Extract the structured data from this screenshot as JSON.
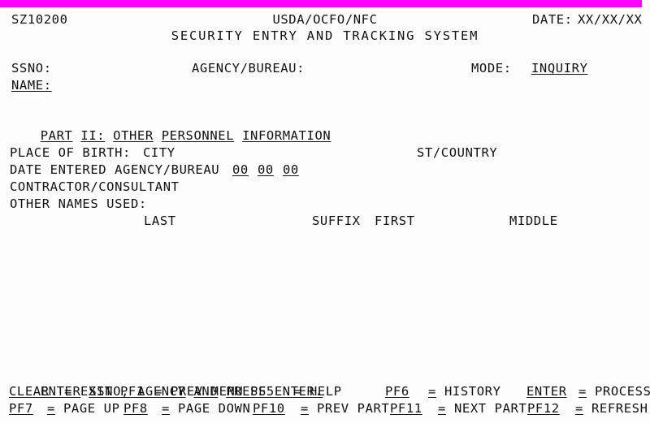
{
  "screen": {
    "id": "SZ10200",
    "bar_color": "#ff00ff",
    "background": "#fdfdfd",
    "text_color": "#111111"
  },
  "header": {
    "screen_id": "SZ10200",
    "org_line": "USDA/OCFO/NFC",
    "system_title": "SECURITY ENTRY AND TRACKING SYSTEM",
    "date_label": "DATE:",
    "date_value": "XX/XX/XX"
  },
  "key_fields": {
    "ssno_label": "SSNO:",
    "ssno_value": "",
    "agency_label": "AGENCY/BUREAU:",
    "agency_value": "",
    "mode_label": "MODE:",
    "mode_value": "INQUIRY",
    "name_label": "NAME:",
    "name_value": ""
  },
  "part": {
    "words": [
      "PART",
      "II:",
      "OTHER",
      "PERSONNEL",
      "INFORMATION"
    ],
    "w0": "PART",
    "w1": "II:",
    "w2": "OTHER",
    "w3": "PERSONNEL",
    "w4": "INFORMATION"
  },
  "body": {
    "place_of_birth_label": "PLACE OF BIRTH:",
    "city_label": "CITY",
    "st_country_label": "ST/COUNTRY",
    "date_entered_label": "DATE ENTERED AGENCY/BUREAU",
    "date_mm": "00",
    "date_dd": "00",
    "date_yy": "00",
    "contractor_label": "CONTRACTOR/CONSULTANT",
    "other_names_label": "OTHER NAMES USED:",
    "col_last": "LAST",
    "col_suffix": "SUFFIX",
    "col_first": "FIRST",
    "col_middle": "MIDDLE"
  },
  "footer": {
    "instruction_words": [
      "ENTER",
      "SSNO,",
      "AGENCY",
      "AND",
      "PRESS",
      "ENTER."
    ],
    "i0": "ENTER",
    "i1": "SSNO,",
    "i2": "AGENCY",
    "i3": "AND",
    "i4": "PRESS",
    "i5": "ENTER.",
    "line1": [
      {
        "key": "CLEAR",
        "eq": "=",
        "action": "EXIT"
      },
      {
        "key": "PF1",
        "eq": "=",
        "action": "PREV MENU"
      },
      {
        "key": "PF5",
        "eq": "=",
        "action": "HELP"
      },
      {
        "key": "PF6",
        "eq": "=",
        "action": "HISTORY"
      },
      {
        "key": "ENTER",
        "eq": "=",
        "action": "PROCESS"
      }
    ],
    "line2": [
      {
        "key": "PF7",
        "eq": "=",
        "action": "PAGE UP"
      },
      {
        "key": "PF8",
        "eq": "=",
        "action": "PAGE DOWN"
      },
      {
        "key": "PF10",
        "eq": "=",
        "action": "PREV PART"
      },
      {
        "key": "PF11",
        "eq": "=",
        "action": "NEXT PART"
      },
      {
        "key": "PF12",
        "eq": "=",
        "action": "REFRESH"
      }
    ],
    "l1k0": "CLEAR",
    "l1e0": "=",
    "l1a0": "EXIT",
    "l1k1": "PF1",
    "l1e1": "=",
    "l1a1": "PREV MENU",
    "l1k2": "PF5",
    "l1e2": "=",
    "l1a2": "HELP",
    "l1k3": "PF6",
    "l1e3": "=",
    "l1a3": "HISTORY",
    "l1k4": "ENTER",
    "l1e4": "=",
    "l1a4": "PROCESS",
    "l2k0": "PF7",
    "l2e0": "=",
    "l2a0": "PAGE UP",
    "l2k1": "PF8",
    "l2e1": "=",
    "l2a1": "PAGE DOWN",
    "l2k2": "PF10",
    "l2e2": "=",
    "l2a2": "PREV PART",
    "l2k3": "PF11",
    "l2e3": "=",
    "l2a3": "NEXT PART",
    "l2k4": "PF12",
    "l2e4": "=",
    "l2a4": "REFRESH"
  }
}
